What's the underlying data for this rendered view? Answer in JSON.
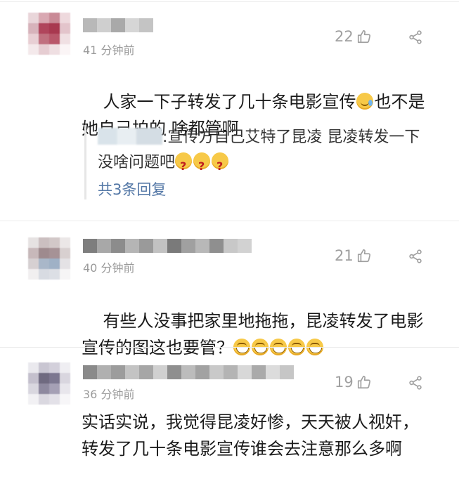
{
  "comments": [
    {
      "time": "41 分钟前",
      "likes": "22",
      "text": "人家一下子转发了几十条电影宣传",
      "text_after_emoji": "也不是她自己拍的 啥都管啊",
      "emoji": "crying-face",
      "reply": {
        "text": ":宣传方自己艾特了昆凌 昆凌转发一下没啥问题吧",
        "emojis": [
          "thinking-face",
          "thinking-face",
          "thinking-face"
        ],
        "more_label": "共3条回复"
      }
    },
    {
      "time": "40 分钟前",
      "likes": "21",
      "text": "有些人没事把家里地拖拖，昆凌转发了电影宣传的图这也要管？",
      "emojis": [
        "grinning-face",
        "grinning-face",
        "grinning-face",
        "grinning-face",
        "grinning-face"
      ]
    },
    {
      "time": "36 分钟前",
      "likes": "19",
      "text": "实话实说，我觉得昆凌好惨，天天被人视奸，转发了几十条电影宣传谁会去注意那么多啊"
    }
  ],
  "colors": {
    "time_gray": "#9a9a9a",
    "like_gray": "#a0a0a0",
    "link_blue": "#5377a6",
    "divider": "#ececec"
  },
  "icons": {
    "like": "thumbs-up-icon",
    "share": "share-icon"
  }
}
